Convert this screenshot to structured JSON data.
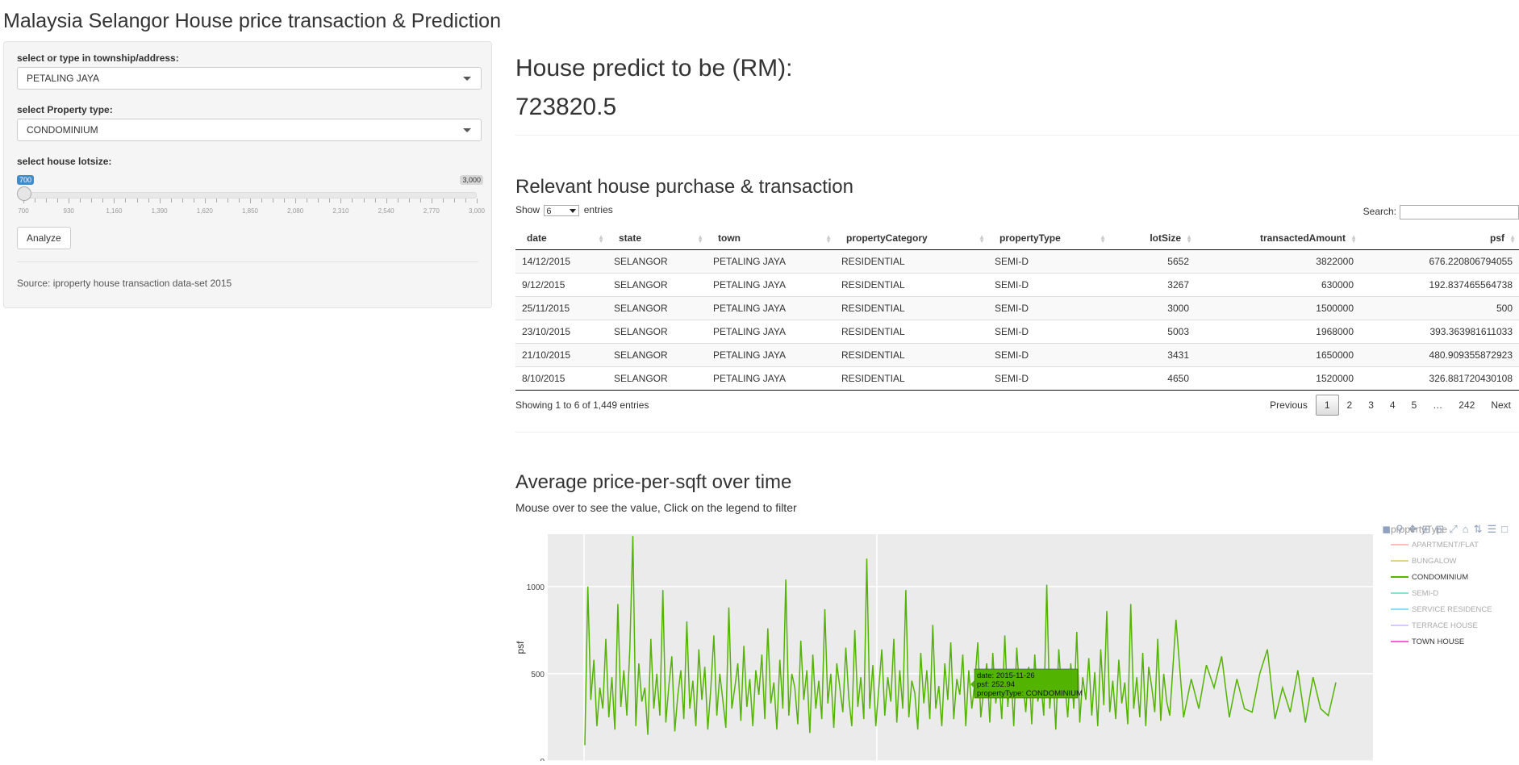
{
  "app_title": "Malaysia Selangor House price transaction & Prediction",
  "sidebar": {
    "township_label": "select or type in township/address:",
    "township_value": "PETALING JAYA",
    "property_label": "select Property type:",
    "property_value": "CONDOMINIUM",
    "lotsize_label": "select house lotsize:",
    "lotsize_value": "700",
    "lotsize_max": "3,000",
    "lotsize_ticks": [
      "700",
      "930",
      "1,160",
      "1,390",
      "1,620",
      "1,850",
      "2,080",
      "2,310",
      "2,540",
      "2,770",
      "3,000"
    ],
    "analyze_label": "Analyze",
    "source_text": "Source: iproperty house transaction data-set 2015"
  },
  "prediction": {
    "heading": "House predict to be (RM):",
    "value": "723820.5"
  },
  "table_section": {
    "heading": "Relevant house purchase & transaction",
    "show_label": "Show",
    "show_value": "6",
    "entries_label": "entries",
    "search_label": "Search:",
    "columns": [
      "date",
      "state",
      "town",
      "propertyCategory",
      "propertyType",
      "lotSize",
      "transactedAmount",
      "psf"
    ],
    "rows": [
      [
        "14/12/2015",
        "SELANGOR",
        "PETALING JAYA",
        "RESIDENTIAL",
        "SEMI-D",
        "5652",
        "3822000",
        "676.220806794055"
      ],
      [
        "9/12/2015",
        "SELANGOR",
        "PETALING JAYA",
        "RESIDENTIAL",
        "SEMI-D",
        "3267",
        "630000",
        "192.837465564738"
      ],
      [
        "25/11/2015",
        "SELANGOR",
        "PETALING JAYA",
        "RESIDENTIAL",
        "SEMI-D",
        "3000",
        "1500000",
        "500"
      ],
      [
        "23/10/2015",
        "SELANGOR",
        "PETALING JAYA",
        "RESIDENTIAL",
        "SEMI-D",
        "5003",
        "1968000",
        "393.363981611033"
      ],
      [
        "21/10/2015",
        "SELANGOR",
        "PETALING JAYA",
        "RESIDENTIAL",
        "SEMI-D",
        "3431",
        "1650000",
        "480.909355872923"
      ],
      [
        "8/10/2015",
        "SELANGOR",
        "PETALING JAYA",
        "RESIDENTIAL",
        "SEMI-D",
        "4650",
        "1520000",
        "326.881720430108"
      ]
    ],
    "info": "Showing 1 to 6 of 1,449 entries",
    "pager": [
      "Previous",
      "1",
      "2",
      "3",
      "4",
      "5",
      "…",
      "242",
      "Next"
    ],
    "current_page": "1"
  },
  "chart_section": {
    "heading": "Average price-per-sqft over time",
    "subtitle": "Mouse over to see the value, Click on the legend to filter",
    "legend_title": "propertyType"
  },
  "chart_data": {
    "type": "line",
    "xlabel": "",
    "ylabel": "psf",
    "ylim": [
      0,
      1300
    ],
    "yticks": [
      0,
      500,
      1000
    ],
    "grid": true,
    "legend_position": "right",
    "legend": [
      {
        "name": "APARTMENT/FLAT",
        "color": "#f8766d",
        "active": false
      },
      {
        "name": "BUNGALOW",
        "color": "#c49a00",
        "active": false
      },
      {
        "name": "CONDOMINIUM",
        "color": "#53b400",
        "active": true
      },
      {
        "name": "SEMI-D",
        "color": "#00c094",
        "active": false
      },
      {
        "name": "SERVICE RESIDENCE",
        "color": "#00b6eb",
        "active": false
      },
      {
        "name": "TERRACE HOUSE",
        "color": "#a58aff",
        "active": false
      },
      {
        "name": "TOWN HOUSE",
        "color": "#fb61d7",
        "active": true
      }
    ],
    "series": [
      {
        "name": "CONDOMINIUM",
        "values": [
          90,
          1000,
          350,
          580,
          200,
          420,
          300,
          700,
          250,
          480,
          180,
          900,
          310,
          520,
          260,
          650,
          1290,
          200,
          560,
          340,
          420,
          150,
          700,
          300,
          500,
          260,
          980,
          220,
          430,
          600,
          170,
          380,
          520,
          240,
          800,
          300,
          460,
          200,
          640,
          350,
          540,
          180,
          420,
          720,
          260,
          500,
          350,
          190,
          880,
          300,
          420,
          560,
          230,
          660,
          310,
          470,
          200,
          520,
          380,
          610,
          240,
          760,
          330,
          450,
          180,
          580,
          300,
          1040,
          260,
          500,
          420,
          210,
          690,
          350,
          520,
          160,
          610,
          300,
          460,
          240,
          870,
          330,
          500,
          190,
          560,
          420,
          280,
          650,
          360,
          200,
          750,
          310,
          480,
          240,
          1160,
          300,
          550,
          200,
          420,
          640,
          260,
          480,
          340,
          700,
          220,
          520,
          300,
          980,
          250,
          460,
          390,
          180,
          620,
          330,
          520,
          240,
          780,
          300,
          430,
          200,
          560,
          350,
          680,
          240,
          470,
          380,
          610,
          200,
          520,
          300,
          450,
          680,
          250,
          410,
          560,
          220,
          620,
          330,
          480,
          240,
          720,
          310,
          520,
          200,
          650,
          380,
          460,
          280,
          540,
          210,
          610,
          340,
          450,
          260,
          1010,
          300,
          520,
          180,
          640,
          380,
          450,
          250,
          560,
          300,
          740,
          220,
          480,
          350,
          590,
          260,
          510,
          200,
          640,
          320,
          860,
          280,
          460,
          240,
          580,
          330,
          450,
          210,
          900,
          300,
          480,
          250,
          620,
          200,
          540,
          420,
          280,
          700,
          230,
          500,
          340,
          260,
          810,
          250,
          470,
          300,
          550,
          420,
          600,
          250,
          470,
          300,
          280,
          500,
          640,
          240,
          420,
          280,
          520,
          220,
          480,
          300,
          260,
          450
        ]
      }
    ],
    "tooltip": {
      "date": "date: 2015-11-26",
      "psf": "psf: 252.94",
      "type": "propertyType: CONDOMINIUM"
    }
  }
}
